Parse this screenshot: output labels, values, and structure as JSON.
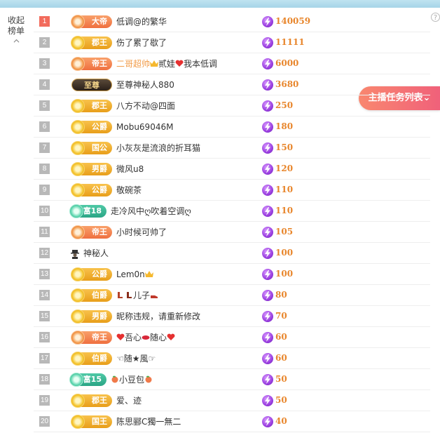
{
  "panel": {
    "collapse_label": "收起\n榜单",
    "help_symbol": "?",
    "task_button": "主播任务列表"
  },
  "ranking": [
    {
      "rank": "1",
      "badge": "大帝",
      "badge_style": "orange",
      "name": "低调@的繁华",
      "value": "140059"
    },
    {
      "rank": "2",
      "badge": "郡王",
      "badge_style": "gold",
      "name": "伤了累了歇了",
      "value": "11111"
    },
    {
      "rank": "3",
      "badge": "帝王",
      "badge_style": "orange",
      "name_a": "二哥超帅",
      "name_b": "贰娃",
      "name_c": "我本低调",
      "value": "6000"
    },
    {
      "rank": "4",
      "badge": "至尊",
      "badge_style": "dark",
      "name": "至尊神秘人880",
      "value": "3680"
    },
    {
      "rank": "5",
      "badge": "郡王",
      "badge_style": "gold",
      "name": "八方不动@四面",
      "value": "250"
    },
    {
      "rank": "6",
      "badge": "公爵",
      "badge_style": "gold",
      "name": "Mobu69046M",
      "value": "180"
    },
    {
      "rank": "7",
      "badge": "国公",
      "badge_style": "gold",
      "name": "小灰灰是流浪的折耳猫",
      "value": "150"
    },
    {
      "rank": "8",
      "badge": "男爵",
      "badge_style": "gold",
      "name": "微风u8",
      "value": "120"
    },
    {
      "rank": "9",
      "badge": "公爵",
      "badge_style": "gold",
      "name": "敬碗茶",
      "value": "110"
    },
    {
      "rank": "10",
      "badge": "富18",
      "badge_style": "teal",
      "name": "走冷风中ღ吹着空调ღ",
      "value": "110"
    },
    {
      "rank": "11",
      "badge": "帝王",
      "badge_style": "orange",
      "name": "小时候可帅了",
      "value": "105"
    },
    {
      "rank": "12",
      "badge": "",
      "badge_style": "none",
      "name": "神秘人",
      "value": "100"
    },
    {
      "rank": "13",
      "badge": "公爵",
      "badge_style": "gold",
      "name": "Lem0n",
      "value": "100"
    },
    {
      "rank": "14",
      "badge": "伯爵",
      "badge_style": "gold",
      "name": "儿子",
      "value": "80"
    },
    {
      "rank": "15",
      "badge": "男爵",
      "badge_style": "gold",
      "name": "昵称违规，请重新修改",
      "value": "70"
    },
    {
      "rank": "16",
      "badge": "帝王",
      "badge_style": "orange",
      "name_a": "吾心",
      "name_b": "随心",
      "value": "60"
    },
    {
      "rank": "17",
      "badge": "伯爵",
      "badge_style": "gold",
      "name": "☜随★風☞",
      "value": "60"
    },
    {
      "rank": "18",
      "badge": "富15",
      "badge_style": "teal",
      "name": "小豆包",
      "value": "50"
    },
    {
      "rank": "19",
      "badge": "郡王",
      "badge_style": "gold",
      "name": "爱、迹",
      "value": "50"
    },
    {
      "rank": "20",
      "badge": "国王",
      "badge_style": "gold",
      "name": "陈思郦C獨一無二",
      "value": "40"
    }
  ],
  "icons": {
    "coin": "purple-lightning-coin-icon",
    "mystery": "mystery-user-icon",
    "collapse_chevron": "chevron-up-icon"
  },
  "colors": {
    "top_rank": "#f26b5c",
    "value_text": "#e8862c",
    "task_button": "#f0617a"
  }
}
